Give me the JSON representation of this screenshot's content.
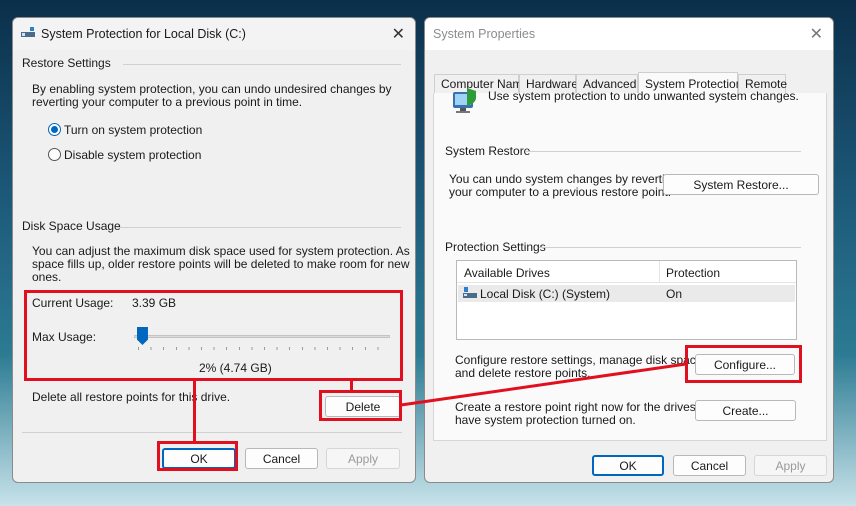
{
  "left_dialog": {
    "title": "System Protection for Local Disk (C:)",
    "restore_settings": {
      "heading": "Restore Settings",
      "description_line1": "By enabling system protection, you can undo undesired changes by",
      "description_line2": "reverting your computer to a previous point in time.",
      "options": [
        {
          "label": "Turn on system protection",
          "selected": true
        },
        {
          "label": "Disable system protection",
          "selected": false
        }
      ]
    },
    "disk_space": {
      "heading": "Disk Space Usage",
      "description_line1": "You can adjust the maximum disk space used for system protection. As",
      "description_line2": "space fills up, older restore points will be deleted to make room for new",
      "description_line3": "ones.",
      "current_usage_label": "Current Usage:",
      "current_usage_value": "3.39 GB",
      "max_usage_label": "Max Usage:",
      "max_usage_percent": 2,
      "max_usage_readout": "2% (4.74 GB)",
      "delete_text": "Delete all restore points for this drive.",
      "delete_button": "Delete"
    },
    "buttons": {
      "ok": "OK",
      "cancel": "Cancel",
      "apply": "Apply"
    }
  },
  "right_dialog": {
    "title": "System Properties",
    "tabs": [
      "Computer Name",
      "Hardware",
      "Advanced",
      "System Protection",
      "Remote"
    ],
    "active_tab": "System Protection",
    "intro_text": "Use system protection to undo unwanted system changes.",
    "system_restore": {
      "heading": "System Restore",
      "text_line1": "You can undo system changes by reverting",
      "text_line2": "your computer to a previous restore point.",
      "button": "System Restore..."
    },
    "protection_settings": {
      "heading": "Protection Settings",
      "columns": [
        "Available Drives",
        "Protection"
      ],
      "rows": [
        {
          "drive": "Local Disk (C:) (System)",
          "protection": "On"
        }
      ],
      "configure_text_line1": "Configure restore settings, manage disk space,",
      "configure_text_line2": "and delete restore points.",
      "configure_button": "Configure...",
      "create_text_line1": "Create a restore point right now for the drives that",
      "create_text_line2": "have system protection turned on.",
      "create_button": "Create..."
    },
    "buttons": {
      "ok": "OK",
      "cancel": "Cancel",
      "apply": "Apply"
    }
  },
  "colors": {
    "highlight": "#e0101f",
    "accent": "#0067c0"
  }
}
